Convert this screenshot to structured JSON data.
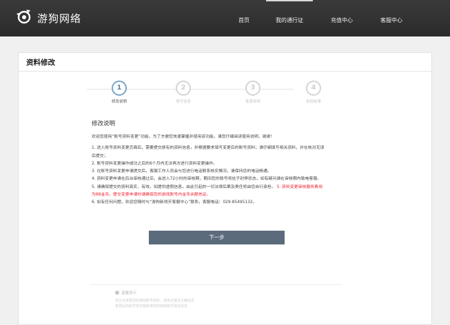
{
  "header": {
    "logo_text": "游狗网络",
    "nav": [
      {
        "label": "首页",
        "active": false
      },
      {
        "label": "我的通行证",
        "active": true
      },
      {
        "label": "充值中心",
        "active": false
      },
      {
        "label": "客服中心",
        "active": false
      }
    ]
  },
  "panel": {
    "title": "资料修改",
    "steps": [
      {
        "number": "1",
        "label": "修改说明",
        "active": true
      },
      {
        "number": "2",
        "label": "填写信息",
        "active": false
      },
      {
        "number": "3",
        "label": "客服审核",
        "active": false
      },
      {
        "number": "4",
        "label": "审核结果",
        "active": false
      }
    ],
    "section_title": "修改说明",
    "intro": "欢迎您使用“账号资料变更”功能，为了方便您快速掌握并使用该功能，请您仔细阅读使用说明，谢谢！",
    "items": [
      "1. 进入账号资料变更页面后，需要提交原有的资料信息，并根据要求填写变更后的账号资料；请仔细填写相关资料，并在核对无误",
      "后提交；",
      "2. 账号资料变更操作成功之后的6个月内无法再次进行资料变更操作。",
      "3. 在账号资料变更申请提交后，客服工作人员会与您进行电话联系核实情况，请保持您的电话畅通。",
      "4. 资料变更申请在后台审核通过后，会进入72小时的审核期，期间您的账号将处于封停状态，如有疑问请在审核期内致电客服。"
    ],
    "item5_normal": "5. 请确保提交的资料真实、有效。如提供虚假信息，由此引起的一切法律后果及责任将由您自行承担。 ",
    "item5_red_a": "5. 资料变更审核服务费用",
    "item5_red_b": "为88金币，提交变更申请时请确保您的游戏账号内金币余额充足。",
    "item6": "6. 如有任何问题，欢迎您随时与“游狗新领天客服中心”联系，客服电话：029-85495132。",
    "next_button": "下一步",
    "tips": {
      "title": "温馨提示",
      "lines": [
        "您正在变更您的游戏账号资料，请务必填写正确信息",
        "变更后的账号将可能影响您的游戏账号相关信息"
      ]
    }
  }
}
